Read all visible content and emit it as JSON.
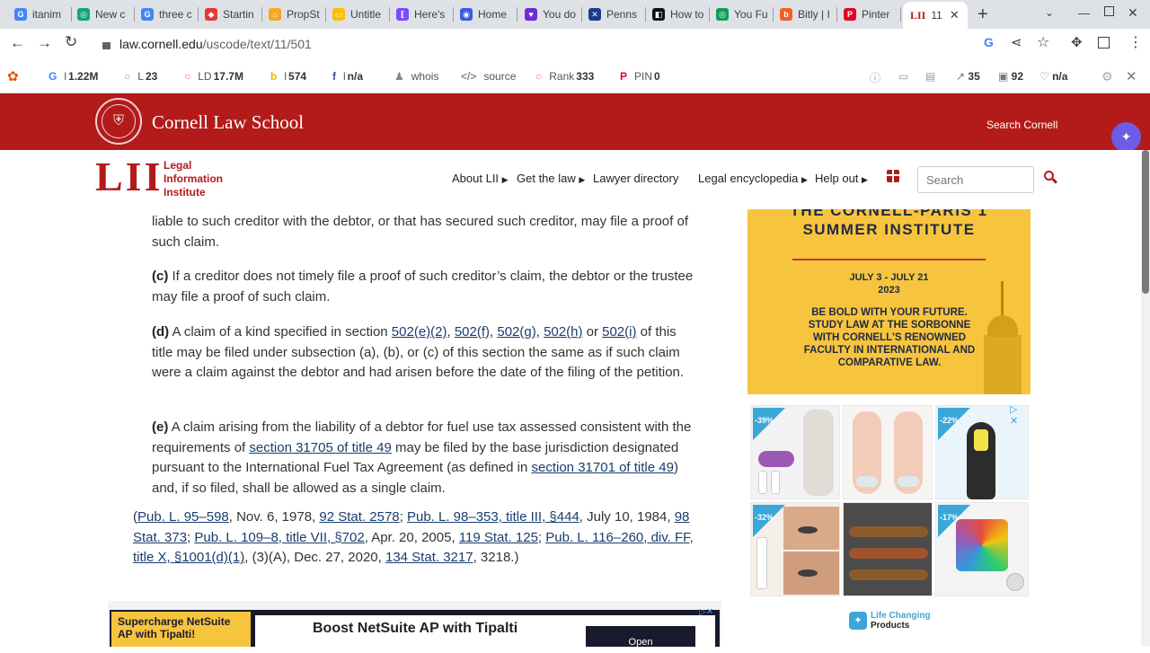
{
  "browser": {
    "tabs": [
      {
        "label": "itanim",
        "fav_color": "#4285f4",
        "fav_glyph": "G"
      },
      {
        "label": "New c",
        "fav_color": "#10a37f",
        "fav_glyph": "◎"
      },
      {
        "label": "three c",
        "fav_color": "#4285f4",
        "fav_glyph": "G"
      },
      {
        "label": "Startin",
        "fav_color": "#e53935",
        "fav_glyph": "◆"
      },
      {
        "label": "PropSt",
        "fav_color": "#f5a623",
        "fav_glyph": "⌂"
      },
      {
        "label": "Untitle",
        "fav_color": "#fbbc04",
        "fav_glyph": "▭"
      },
      {
        "label": "Here's",
        "fav_color": "#7b4bff",
        "fav_glyph": "⁅"
      },
      {
        "label": "Home",
        "fav_color": "#3b5bdb",
        "fav_glyph": "◉"
      },
      {
        "label": "You do",
        "fav_color": "#6e2bd6",
        "fav_glyph": "♥"
      },
      {
        "label": "Penns",
        "fav_color": "#1e3a8a",
        "fav_glyph": "✕"
      },
      {
        "label": "How to",
        "fav_color": "#111111",
        "fav_glyph": "◧"
      },
      {
        "label": "You Fu",
        "fav_color": "#0f9d58",
        "fav_glyph": "◎"
      },
      {
        "label": "Bitly | I",
        "fav_color": "#ee6123",
        "fav_glyph": "b"
      },
      {
        "label": "Pinter",
        "fav_color": "#e60023",
        "fav_glyph": "P"
      }
    ],
    "active_tab": {
      "label": "11",
      "logo": "LII"
    },
    "url_domain": "law.cornell.edu",
    "url_path": "/uscode/text/11/501"
  },
  "extension_bar": {
    "items": [
      {
        "icon": "G",
        "label": "l",
        "value": "1.22M",
        "color": "#4285f4"
      },
      {
        "icon": "○",
        "label": "L",
        "value": "23",
        "color": "#e57373"
      },
      {
        "icon": "○",
        "label": "LD",
        "value": "17.7M",
        "color": "#e57373"
      },
      {
        "icon": "b",
        "label": "l",
        "value": "574",
        "color": "#f5b700"
      },
      {
        "icon": "f",
        "label": "l",
        "value": "n/a",
        "color": "#3b5998"
      },
      {
        "icon": "♟",
        "label": "whois",
        "value": "",
        "color": "#888888"
      },
      {
        "icon": "</>",
        "label": "source",
        "value": "",
        "color": "#888888"
      },
      {
        "icon": "○",
        "label": "Rank",
        "value": "333",
        "color": "#e57373"
      },
      {
        "icon": "P",
        "label": "PIN",
        "value": "0",
        "color": "#e60023"
      }
    ],
    "right_values": [
      "35",
      "92",
      "n/a"
    ]
  },
  "cornell_header": {
    "school_name": "Cornell Law School",
    "search_link": "Search Cornell",
    "bg_color": "#b31b1b"
  },
  "lii_header": {
    "logo_letters": "LII",
    "logo_lines": [
      "Legal",
      "Information",
      "Institute"
    ],
    "nav": [
      "About LII",
      "Get the law",
      "Lawyer directory",
      "Legal encyclopedia",
      "Help out"
    ],
    "search_placeholder": "Search"
  },
  "statute": {
    "para_b_tail": "liable to such creditor with the debtor, or that has secured such creditor, may file a proof of such claim.",
    "para_c": {
      "label": "(c)",
      "text": "If a creditor does not timely file a proof of such creditor’s claim, the debtor or the trustee may file a proof of such claim."
    },
    "para_d": {
      "label": "(d)",
      "t1": "A claim of a kind specified in section",
      "links": [
        "502(e)(2)",
        "502(f)",
        "502(g)",
        "502(h)",
        "502(i)"
      ],
      "t2": "of this title may be filed under subsection (a), (b), or (c) of this section the same as if such claim were a claim against the debtor and had arisen before the date of the filing of the petition."
    },
    "para_e": {
      "label": "(e)",
      "t1": "A claim arising from the liability of a debtor for fuel use tax assessed consistent with the requirements of",
      "link1": "section 31705 of title 49",
      "t2": "may be filed by the base jurisdiction designated pursuant to the International Fuel Tax Agreement (as defined in",
      "link2": "section 31701 of title 49",
      "t3": ") and, if so filed, shall be allowed as a single claim."
    },
    "history": {
      "l1": "Pub. L. 95–598",
      "t1": ", Nov. 6, 1978,",
      "l2": "92 Stat. 2578",
      "t2": ";",
      "l3": "Pub. L. 98–353, title III, §444",
      "t3": ", July 10, 1984,",
      "l4": "98 Stat. 373",
      "t4": ";",
      "l5": "Pub. L. 109–8, title VII, §702",
      "t5": ", Apr. 20, 2005,",
      "l6": "119 Stat. 125",
      "t6": ";",
      "l7": "Pub. L. 116–260, div. FF, title X, §1001(d)(1)",
      "t7": ", (3)(A), Dec. 27, 2020,",
      "l8": "134 Stat. 3217",
      "t8": ", 3218.)"
    }
  },
  "ad_banner": {
    "lines": [
      "THE CORNELL-PARIS 1",
      "SUMMER INSTITUTE"
    ],
    "dates": "JULY 3 - JULY 21",
    "year": "2023",
    "body": [
      "BE BOLD WITH YOUR FUTURE.",
      "STUDY LAW AT THE SORBONNE",
      "WITH CORNELL'S RENOWNED",
      "FACULTY IN INTERNATIONAL AND",
      "COMPARATIVE LAW."
    ],
    "bg_color": "#f7c43d"
  },
  "product_ads": {
    "discounts": [
      "-39%",
      "-22%",
      "-32%",
      "-17%"
    ],
    "brand": [
      "Life Changing",
      "Products"
    ]
  },
  "bottom_ad": {
    "left": [
      "Supercharge NetSuite",
      "AP with Tipalti!"
    ],
    "headline": "Boost NetSuite AP with Tipalti",
    "button": "Open"
  }
}
